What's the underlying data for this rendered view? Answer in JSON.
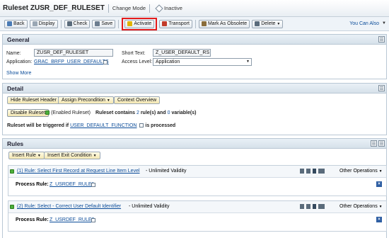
{
  "header": {
    "title": "Ruleset ZUSR_DEF_RULESET",
    "mode": "Change Mode",
    "status": "Inactive"
  },
  "toolbar": {
    "back": "Back",
    "display": "Display",
    "check": "Check",
    "save": "Save",
    "activate": "Activate",
    "transport": "Transport",
    "mark_obsolete": "Mark As Obsolete",
    "delete": "Delete",
    "you_can_also": "You Can Also"
  },
  "general": {
    "heading": "General",
    "name_label": "Name:",
    "name_value": "ZUSR_DEF_RULESET",
    "application_label": "Application:",
    "application_value": "GRAC_BRFP_USER_DEFAULTS",
    "short_text_label": "Short Text:",
    "short_text_value": "Z_USER_DEFAULT_RS",
    "access_level_label": "Access Level:",
    "access_level_value": "Application",
    "show_more": "Show More"
  },
  "detail": {
    "heading": "Detail",
    "hide_header_btn": "Hide Ruleset Header",
    "assign_precondition_btn": "Assign Precondition",
    "context_overview_btn": "Context Overview",
    "disable_ruleset_btn": "Disable Ruleset",
    "enabled_text": "(Enabled Ruleset)",
    "contains_prefix": "Ruleset contains",
    "rule_count": "2",
    "rule_word": "rule(s) and",
    "var_count": "0",
    "var_word": "variable(s)",
    "trigger_prefix": "Ruleset will be triggered if",
    "trigger_function": "USER_DEFAULT_FUNCTION",
    "trigger_suffix": "is processed"
  },
  "rules": {
    "heading": "Rules",
    "insert_rule_btn": "Insert Rule",
    "insert_exit_btn": "Insert Exit Condition",
    "items": [
      {
        "title": "(1) Rule: Select First Record at Request Line Item Level",
        "validity": "- Unlimited Validity",
        "other_ops": "Other Operations",
        "process_label": "Process Rule:",
        "process_value": "Z_USRDEF_RULE1"
      },
      {
        "title": "(2) Rule: Select - Correct User Default Identifier",
        "validity": "- Unlimited Validity",
        "other_ops": "Other Operations",
        "process_label": "Process Rule:",
        "process_value": "Z_USRDEF_RULE2"
      }
    ]
  },
  "colors": {
    "accent_link": "#0b4c99",
    "highlight_border": "#e41b1b",
    "enabled_green": "#4caf3a"
  }
}
